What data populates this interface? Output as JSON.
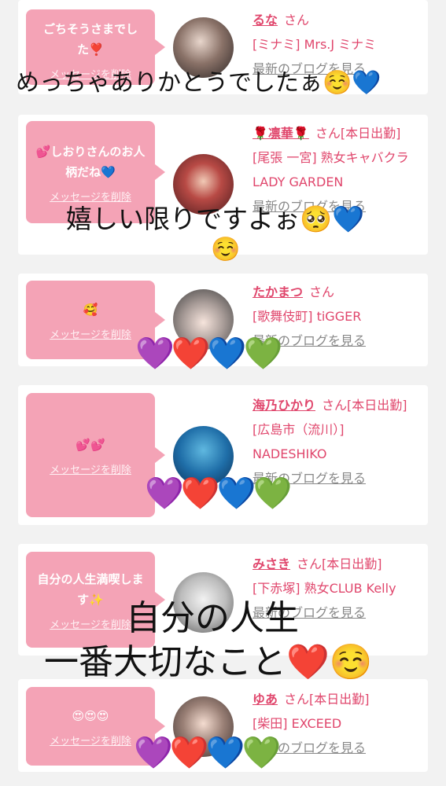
{
  "cards": [
    {
      "message": "ごちそうさまでした❣️",
      "delete_label": "メッセージを削除",
      "name": "るな",
      "honorific": "さん",
      "shop": "[ミナミ] Mrs.J ミナミ",
      "blog": "最新のブログを見る"
    },
    {
      "message": "💕しおりさんのお人柄だね💙",
      "delete_label": "メッセージを削除",
      "name": "🌹凛華🌹",
      "honorific": "さん[本日出勤]",
      "shop": "[尾張 一宮] 熟女キャバクラ LADY GARDEN",
      "blog": "最新のブログを見る"
    },
    {
      "message": "🥰",
      "delete_label": "メッセージを削除",
      "name": "たかまつ",
      "honorific": "さん",
      "shop": "[歌舞伎町] tiGGER",
      "blog": "最新のブログを見る"
    },
    {
      "message": "💕💕",
      "delete_label": "メッセージを削除",
      "name": "海乃ひかり",
      "honorific": "さん[本日出勤]",
      "shop": "[広島市（流川）] NADESHIKO",
      "blog": "最新のブログを見る"
    },
    {
      "message": "自分の人生満喫します✨",
      "delete_label": "メッセージを削除",
      "name": "みさき",
      "honorific": "さん[本日出勤]",
      "shop": "[下赤塚] 熟女CLUB Kelly",
      "blog": "最新のブログを見る"
    },
    {
      "message": "😍😍😍",
      "delete_label": "メッセージを削除",
      "name": "ゆあ",
      "honorific": "さん[本日出勤]",
      "shop": "[柴田] EXCEED",
      "blog": "最新のブログを見る"
    }
  ],
  "overlays": {
    "caption1": "めっちゃありかとうでしたぁ",
    "caption1_emoji": "☺️💙",
    "caption2": "嬉しい限りですよぉ",
    "caption2_emoji": "🥺💙",
    "caption2_emoji2": "☺️",
    "caption3_line1": "自分の人生",
    "caption3_line2": "一番大切なこと",
    "caption3_emoji": "❤️☺️",
    "hearts": [
      "💜",
      "❤️",
      "💙",
      "💚"
    ]
  },
  "colors": {
    "bubble": "#f4a3b6",
    "accent": "#e0466c",
    "background": "#f2f2f2"
  }
}
